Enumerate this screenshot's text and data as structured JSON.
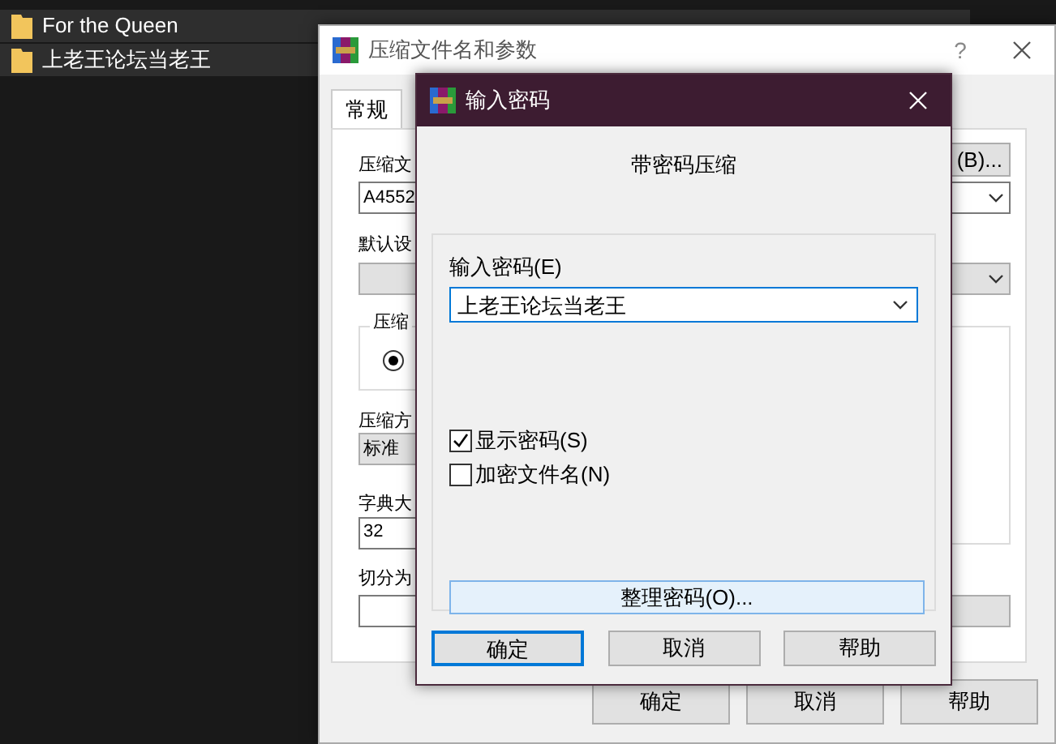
{
  "explorer": {
    "rows": [
      {
        "name": "For the Queen",
        "selected": true
      },
      {
        "name": "上老王论坛当老王",
        "selected": true
      }
    ]
  },
  "archive_dialog": {
    "title": "压缩文件名和参数",
    "help": "?",
    "tabs": [
      {
        "label": "常规",
        "selected": true
      }
    ],
    "archive_name_label": "压缩文",
    "browse_button": "(B)...",
    "archive_name_value": "A4552",
    "profile_label": "默认设",
    "mode_group_label": "压缩",
    "mode_radio": {
      "selected": true
    },
    "method_label": "压缩方",
    "method_value": "标准",
    "dictionary_label": "字典大",
    "dictionary_value": "32",
    "split_label": "切分为",
    "buttons": [
      "确定",
      "取消",
      "帮助"
    ]
  },
  "password_dialog": {
    "title": "输入密码",
    "heading": "带密码压缩",
    "password_label": "输入密码(E)",
    "password_value": "上老王论坛当老王",
    "options": [
      {
        "label": "显示密码(S)",
        "checked": true
      },
      {
        "label": "加密文件名(N)",
        "checked": false
      }
    ],
    "organize_button": "整理密码(O)...",
    "buttons": [
      {
        "label": "确定",
        "selected": true
      },
      {
        "label": "取消",
        "selected": false
      },
      {
        "label": "帮助",
        "selected": false
      }
    ]
  }
}
